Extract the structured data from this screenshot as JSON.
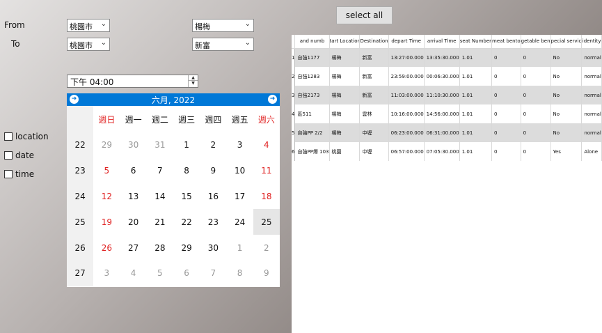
{
  "form": {
    "from_label": "From",
    "to_label": "To",
    "from_city": "桃園市",
    "from_station": "楊梅",
    "to_city": "桃園市",
    "to_station": "新富",
    "time_value": "下午 04:00"
  },
  "select_all_label": "select all",
  "calendar": {
    "month_title": "六月, 2022",
    "weekdays": [
      "週日",
      "週一",
      "週二",
      "週三",
      "週四",
      "週五",
      "週六"
    ],
    "weeks": [
      {
        "wk": "22",
        "days": [
          "29",
          "30",
          "31",
          "1",
          "2",
          "3",
          "4"
        ]
      },
      {
        "wk": "23",
        "days": [
          "5",
          "6",
          "7",
          "8",
          "9",
          "10",
          "11"
        ]
      },
      {
        "wk": "24",
        "days": [
          "12",
          "13",
          "14",
          "15",
          "16",
          "17",
          "18"
        ]
      },
      {
        "wk": "25",
        "days": [
          "19",
          "20",
          "21",
          "22",
          "23",
          "24",
          "25"
        ]
      },
      {
        "wk": "26",
        "days": [
          "26",
          "27",
          "28",
          "29",
          "30",
          "1",
          "2"
        ]
      },
      {
        "wk": "27",
        "days": [
          "3",
          "4",
          "5",
          "6",
          "7",
          "8",
          "9"
        ]
      }
    ],
    "selected": "25"
  },
  "filters": {
    "location": "location",
    "date": "date",
    "time": "time"
  },
  "table": {
    "columns": [
      "and numb",
      "tart Locatior",
      "Destination",
      "depart Time",
      "arrival Time",
      "seat Number",
      "meat bento",
      "getable ben",
      "pecial servic",
      "identity"
    ],
    "rows": [
      {
        "n": "1",
        "cells": [
          "自強1177",
          "楊梅",
          "新富",
          "13:27:00.000",
          "13:35:30.000",
          "1.01",
          "0",
          "0",
          "No",
          "normal"
        ]
      },
      {
        "n": "2",
        "cells": [
          "自強1283",
          "楊梅",
          "新富",
          "23:59:00.000",
          "00:06:30.000",
          "1.01",
          "0",
          "0",
          "No",
          "normal"
        ]
      },
      {
        "n": "3",
        "cells": [
          "自強2173",
          "楊梅",
          "新富",
          "11:03:00.000",
          "11:10:30.000",
          "1.01",
          "0",
          "0",
          "No",
          "normal"
        ]
      },
      {
        "n": "4",
        "cells": [
          "區511",
          "楊梅",
          "雲林",
          "10:16:00.000",
          "14:56:00.000",
          "1.01",
          "0",
          "0",
          "No",
          "normal"
        ]
      },
      {
        "n": "5",
        "cells": [
          "自強PP 2/2",
          "楊梅",
          "中壢",
          "06:23:00.000",
          "06:31:00.000",
          "1.01",
          "0",
          "0",
          "No",
          "normal"
        ]
      },
      {
        "n": "6",
        "cells": [
          "自強PP爆 103",
          "桃園",
          "中壢",
          "06:57:00.000",
          "07:05:30.000",
          "1.01",
          "0",
          "0",
          "Yes",
          "Alone"
        ]
      }
    ]
  }
}
